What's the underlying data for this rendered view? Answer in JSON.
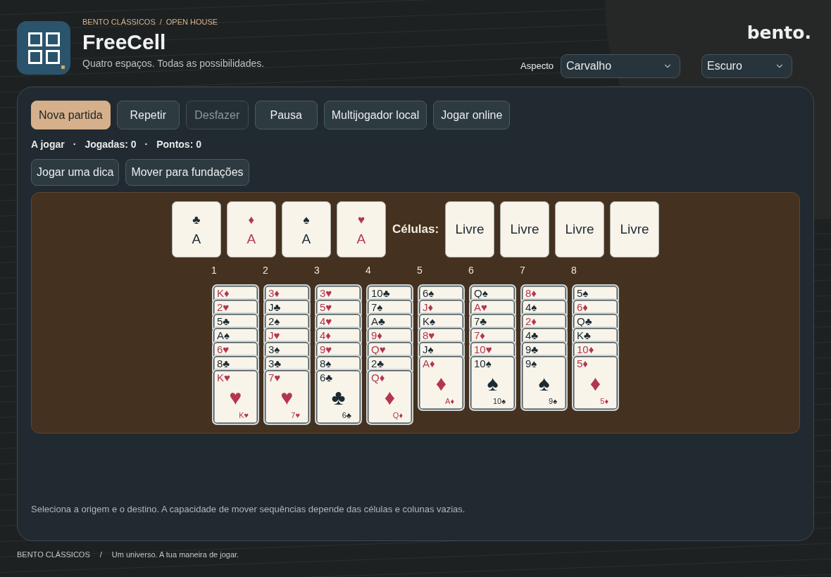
{
  "header": {
    "breadcrumb": {
      "items": [
        {
          "label": "BENTO CLÁSSICOS"
        },
        {
          "label": "OPEN HOUSE"
        }
      ],
      "separator": "/"
    },
    "title": "FreeCell",
    "subtitle": "Quatro espaços. Todas as possibilidades.",
    "brand": "bento.",
    "appearance": {
      "label": "Aspecto",
      "selects": [
        {
          "value": "Carvalho"
        },
        {
          "value": "Escuro"
        }
      ]
    }
  },
  "toolbar": [
    {
      "label": "Nova partida",
      "kind": "primary",
      "disabled": false
    },
    {
      "label": "Repetir",
      "kind": "secondary",
      "disabled": false
    },
    {
      "label": "Desfazer",
      "kind": "secondary",
      "disabled": true
    },
    {
      "label": "Pausa",
      "kind": "secondary",
      "disabled": false
    },
    {
      "label": "Multijogador local",
      "kind": "secondary",
      "disabled": false
    },
    {
      "label": "Jogar online",
      "kind": "secondary",
      "disabled": false
    }
  ],
  "status": {
    "items": [
      "A jogar",
      "Jogadas: 0",
      "Pontos: 0"
    ],
    "separator": "·"
  },
  "actions": [
    {
      "label": "Jogar uma dica"
    },
    {
      "label": "Mover para fundações"
    }
  ],
  "board": {
    "foundations": [
      {
        "suit": "♣",
        "rank": "A",
        "color": "#1c2a33"
      },
      {
        "suit": "♦",
        "rank": "A",
        "color": "#b3364f"
      },
      {
        "suit": "♠",
        "rank": "A",
        "color": "#1c2a33"
      },
      {
        "suit": "♥",
        "rank": "A",
        "color": "#b3364f"
      }
    ],
    "cells_label": "Células:",
    "free_cells": [
      {
        "label": "Livre"
      },
      {
        "label": "Livre"
      },
      {
        "label": "Livre"
      },
      {
        "label": "Livre"
      }
    ],
    "columns": [
      {
        "number": "1",
        "cards": [
          {
            "kind": "stacked",
            "corner": "K♦",
            "color": "#b3364f"
          },
          {
            "kind": "stacked",
            "corner": "2♥",
            "color": "#b3364f"
          },
          {
            "kind": "stacked",
            "corner": "5♣",
            "color": "#1c2a33"
          },
          {
            "kind": "stacked",
            "corner": "A♠",
            "color": "#1c2a33"
          },
          {
            "kind": "stacked",
            "corner": "6♥",
            "color": "#b3364f"
          },
          {
            "kind": "stacked",
            "corner": "8♣",
            "color": "#1c2a33"
          },
          {
            "kind": "open",
            "corner": "K♥",
            "pip": "♥",
            "corner_bottom": "K♥",
            "color": "#b3364f"
          }
        ]
      },
      {
        "number": "2",
        "cards": [
          {
            "kind": "stacked",
            "corner": "3♦",
            "color": "#b3364f"
          },
          {
            "kind": "stacked",
            "corner": "J♣",
            "color": "#1c2a33"
          },
          {
            "kind": "stacked",
            "corner": "2♠",
            "color": "#1c2a33"
          },
          {
            "kind": "stacked",
            "corner": "J♥",
            "color": "#b3364f"
          },
          {
            "kind": "stacked",
            "corner": "3♠",
            "color": "#1c2a33"
          },
          {
            "kind": "stacked",
            "corner": "3♣",
            "color": "#1c2a33"
          },
          {
            "kind": "open",
            "corner": "7♥",
            "pip": "♥",
            "corner_bottom": "7♥",
            "color": "#b3364f"
          }
        ]
      },
      {
        "number": "3",
        "cards": [
          {
            "kind": "stacked",
            "corner": "3♥",
            "color": "#b3364f"
          },
          {
            "kind": "stacked",
            "corner": "5♥",
            "color": "#b3364f"
          },
          {
            "kind": "stacked",
            "corner": "4♥",
            "color": "#b3364f"
          },
          {
            "kind": "stacked",
            "corner": "4♦",
            "color": "#b3364f"
          },
          {
            "kind": "stacked",
            "corner": "9♥",
            "color": "#b3364f"
          },
          {
            "kind": "stacked",
            "corner": "8♠",
            "color": "#1c2a33"
          },
          {
            "kind": "open",
            "corner": "6♣",
            "pip": "♣",
            "corner_bottom": "6♣",
            "color": "#1c2a33"
          }
        ]
      },
      {
        "number": "4",
        "cards": [
          {
            "kind": "stacked",
            "corner": "10♣",
            "color": "#1c2a33"
          },
          {
            "kind": "stacked",
            "corner": "7♠",
            "color": "#1c2a33"
          },
          {
            "kind": "stacked",
            "corner": "A♣",
            "color": "#1c2a33"
          },
          {
            "kind": "stacked",
            "corner": "9♦",
            "color": "#b3364f"
          },
          {
            "kind": "stacked",
            "corner": "Q♥",
            "color": "#b3364f"
          },
          {
            "kind": "stacked",
            "corner": "2♣",
            "color": "#1c2a33"
          },
          {
            "kind": "open",
            "corner": "Q♦",
            "pip": "♦",
            "corner_bottom": "Q♦",
            "color": "#b3364f"
          }
        ]
      },
      {
        "number": "5",
        "cards": [
          {
            "kind": "stacked",
            "corner": "6♠",
            "color": "#1c2a33"
          },
          {
            "kind": "stacked",
            "corner": "J♦",
            "color": "#b3364f"
          },
          {
            "kind": "stacked",
            "corner": "K♠",
            "color": "#1c2a33"
          },
          {
            "kind": "stacked",
            "corner": "8♥",
            "color": "#b3364f"
          },
          {
            "kind": "stacked",
            "corner": "J♠",
            "color": "#1c2a33"
          },
          {
            "kind": "open",
            "corner": "A♦",
            "pip": "♦",
            "corner_bottom": "A♦",
            "color": "#b3364f"
          }
        ]
      },
      {
        "number": "6",
        "cards": [
          {
            "kind": "stacked",
            "corner": "Q♠",
            "color": "#1c2a33"
          },
          {
            "kind": "stacked",
            "corner": "A♥",
            "color": "#b3364f"
          },
          {
            "kind": "stacked",
            "corner": "7♣",
            "color": "#1c2a33"
          },
          {
            "kind": "stacked",
            "corner": "7♦",
            "color": "#b3364f"
          },
          {
            "kind": "stacked",
            "corner": "10♥",
            "color": "#b3364f"
          },
          {
            "kind": "open",
            "corner": "10♠",
            "pip": "♠",
            "corner_bottom": "10♠",
            "color": "#1c2a33"
          }
        ]
      },
      {
        "number": "7",
        "cards": [
          {
            "kind": "stacked",
            "corner": "8♦",
            "color": "#b3364f"
          },
          {
            "kind": "stacked",
            "corner": "4♠",
            "color": "#1c2a33"
          },
          {
            "kind": "stacked",
            "corner": "2♦",
            "color": "#b3364f"
          },
          {
            "kind": "stacked",
            "corner": "4♣",
            "color": "#1c2a33"
          },
          {
            "kind": "stacked",
            "corner": "9♣",
            "color": "#1c2a33"
          },
          {
            "kind": "open",
            "corner": "9♠",
            "pip": "♠",
            "corner_bottom": "9♠",
            "color": "#1c2a33"
          }
        ]
      },
      {
        "number": "8",
        "cards": [
          {
            "kind": "stacked",
            "corner": "5♠",
            "color": "#1c2a33"
          },
          {
            "kind": "stacked",
            "corner": "6♦",
            "color": "#b3364f"
          },
          {
            "kind": "stacked",
            "corner": "Q♣",
            "color": "#1c2a33"
          },
          {
            "kind": "stacked",
            "corner": "K♣",
            "color": "#1c2a33"
          },
          {
            "kind": "stacked",
            "corner": "10♦",
            "color": "#b3364f"
          },
          {
            "kind": "open",
            "corner": "5♦",
            "pip": "♦",
            "corner_bottom": "5♦",
            "color": "#b3364f"
          }
        ]
      }
    ]
  },
  "hint": "Seleciona a origem e o destino. A capacidade de mover sequências depende das células e colunas vazias.",
  "footer": {
    "brand": "BENTO CLÁSSICOS",
    "separator": "/",
    "tagline": "Um universo. A tua maneira de jogar."
  }
}
